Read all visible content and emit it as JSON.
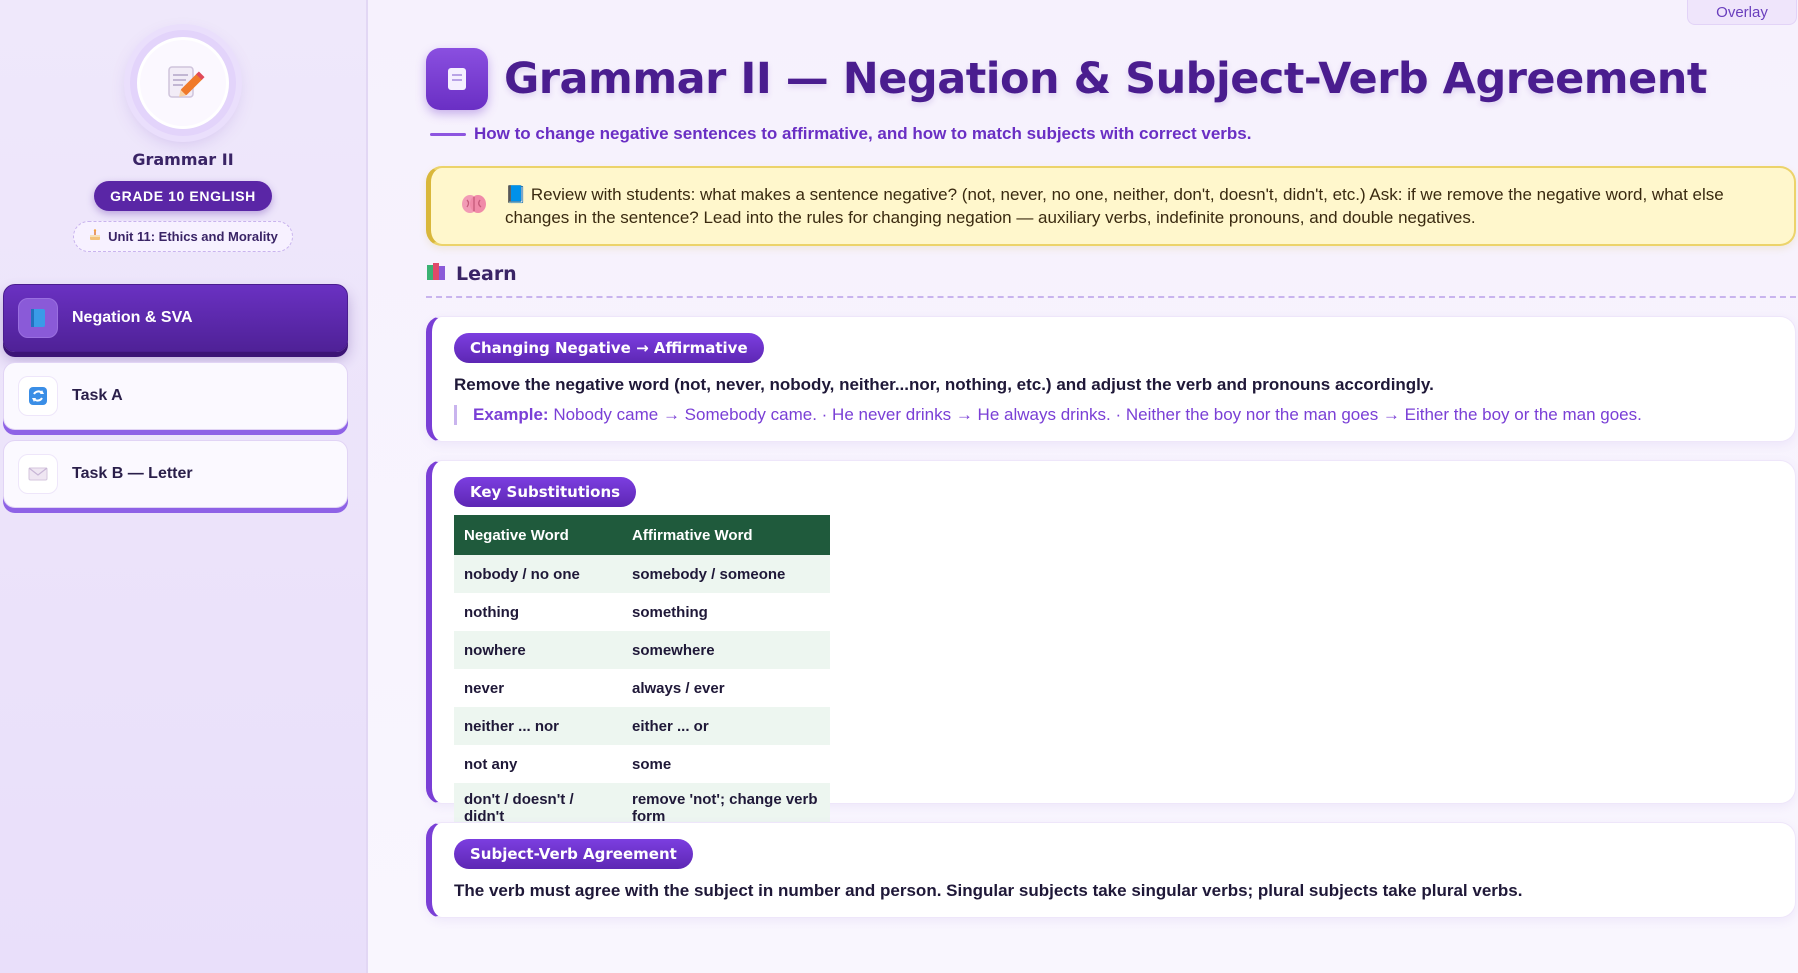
{
  "overlay_label": "Overlay",
  "sidebar": {
    "title": "Grammar II",
    "grade": "GRADE 10 ENGLISH",
    "unit": "Unit 11: Ethics and Morality",
    "items": [
      {
        "label": "Negation & SVA",
        "icon": "book-icon",
        "active": true
      },
      {
        "label": "Task A",
        "icon": "cycle-icon",
        "active": false
      },
      {
        "label": "Task B — Letter",
        "icon": "envelope-icon",
        "active": false
      }
    ]
  },
  "header": {
    "title": "Grammar II — Negation & Subject-Verb Agreement",
    "subtitle": "How to change negative sentences to affirmative, and how to match subjects with correct verbs."
  },
  "note": {
    "text": "📘 Review with students: what makes a sentence negative? (not, never, no one, neither, don't, doesn't, didn't, etc.) Ask: if we remove the negative word, what else changes in the sentence? Lead into the rules for changing negation — auxiliary verbs, indefinite pronouns, and double negatives."
  },
  "learn": {
    "title": "Learn"
  },
  "cards": {
    "negation": {
      "pill": "Changing Negative → Affirmative",
      "text": "Remove the negative word (not, never, nobody, neither...nor, nothing, etc.) and adjust the verb and pronouns accordingly.",
      "example_label": "Example:",
      "example_text": "Nobody came → Somebody came. · He never drinks → He always drinks. · Neither the boy nor the man goes → Either the boy or the man goes."
    },
    "substitutions": {
      "pill": "Key Substitutions",
      "headers": [
        "Negative Word",
        "Affirmative Word"
      ],
      "rows": [
        [
          "nobody / no one",
          "somebody / someone"
        ],
        [
          "nothing",
          "something"
        ],
        [
          "nowhere",
          "somewhere"
        ],
        [
          "never",
          "always / ever"
        ],
        [
          "neither ... nor",
          "either ... or"
        ],
        [
          "not any",
          "some"
        ],
        [
          "don't / doesn't / didn't",
          "remove 'not'; change verb form"
        ]
      ]
    },
    "sva": {
      "pill": "Subject-Verb Agreement",
      "text": "The verb must agree with the subject in number and person. Singular subjects take singular verbs; plural subjects take plural verbs."
    }
  },
  "colors": {
    "accent": "#6a2fc4",
    "title": "#4a1d8f",
    "table_header": "#1f5a3c",
    "note_bg": "#fff7cc"
  }
}
